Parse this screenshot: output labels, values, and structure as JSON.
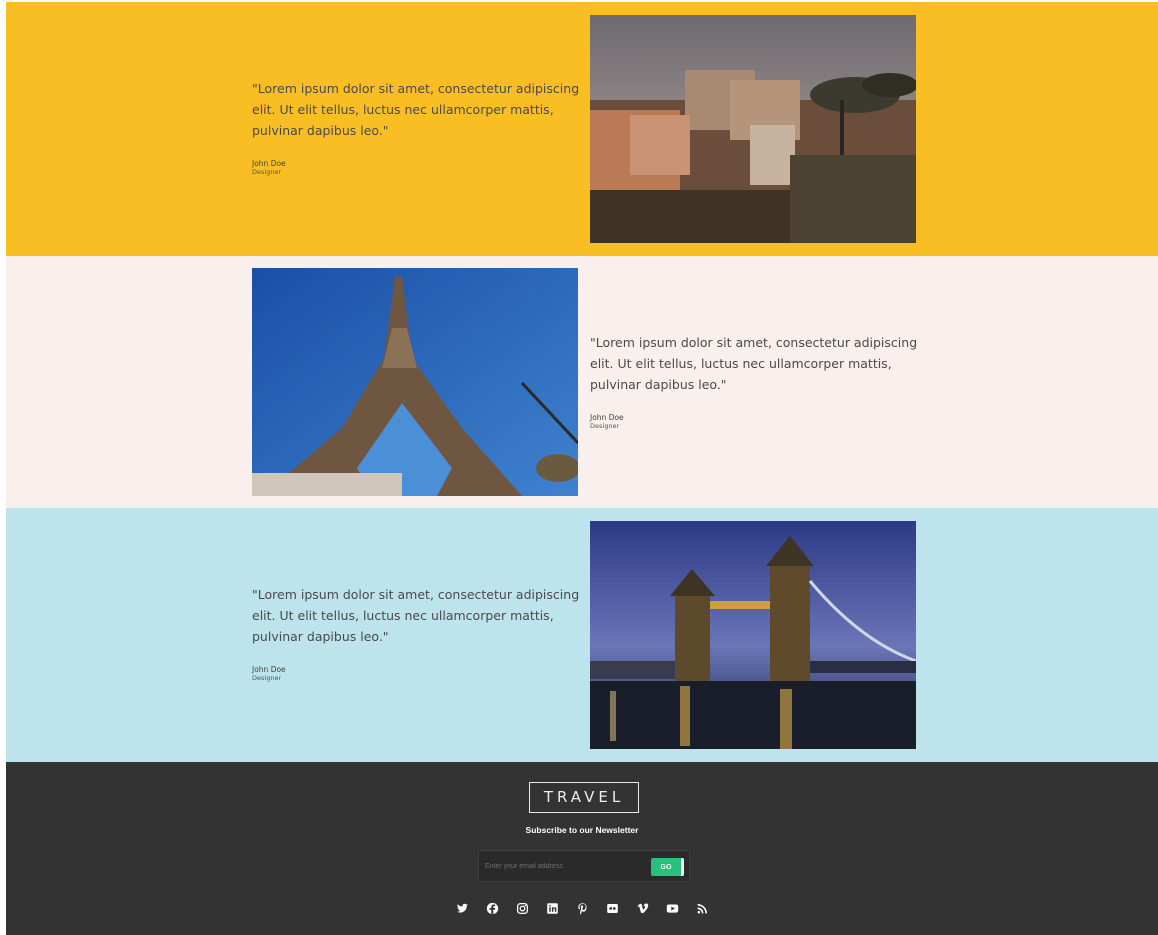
{
  "testimonials": [
    {
      "quote": "\"Lorem ipsum dolor sit amet, consectetur adipiscing elit. Ut elit tellus, luctus nec ullamcorper mattis, pulvinar dapibus leo.\"",
      "author": "John Doe",
      "role": "Designer",
      "image": "rome-colosseum-photo",
      "background": "#f8be24"
    },
    {
      "quote": "\"Lorem ipsum dolor sit amet, consectetur adipiscing elit. Ut elit tellus, luctus nec ullamcorper mattis, pulvinar dapibus leo.\"",
      "author": "John Doe",
      "role": "Designer",
      "image": "paris-eiffel-tower-photo",
      "background": "#f9efec"
    },
    {
      "quote": "\"Lorem ipsum dolor sit amet, consectetur adipiscing elit. Ut elit tellus, luctus nec ullamcorper mattis, pulvinar dapibus leo.\"",
      "author": "John Doe",
      "role": "Designer",
      "image": "london-tower-bridge-photo",
      "background": "#bde3ec"
    }
  ],
  "footer": {
    "logo": "TRAVEL",
    "newsletter_title": "Subscribe to our Newsletter",
    "email_placeholder": "Enter your email address",
    "go_label": "GO",
    "accent": "#27c07d",
    "background": "#333333",
    "social_icons": [
      "twitter-icon",
      "facebook-icon",
      "instagram-icon",
      "linkedin-icon",
      "pinterest-icon",
      "flickr-icon",
      "vimeo-icon",
      "youtube-icon",
      "rss-icon"
    ]
  }
}
